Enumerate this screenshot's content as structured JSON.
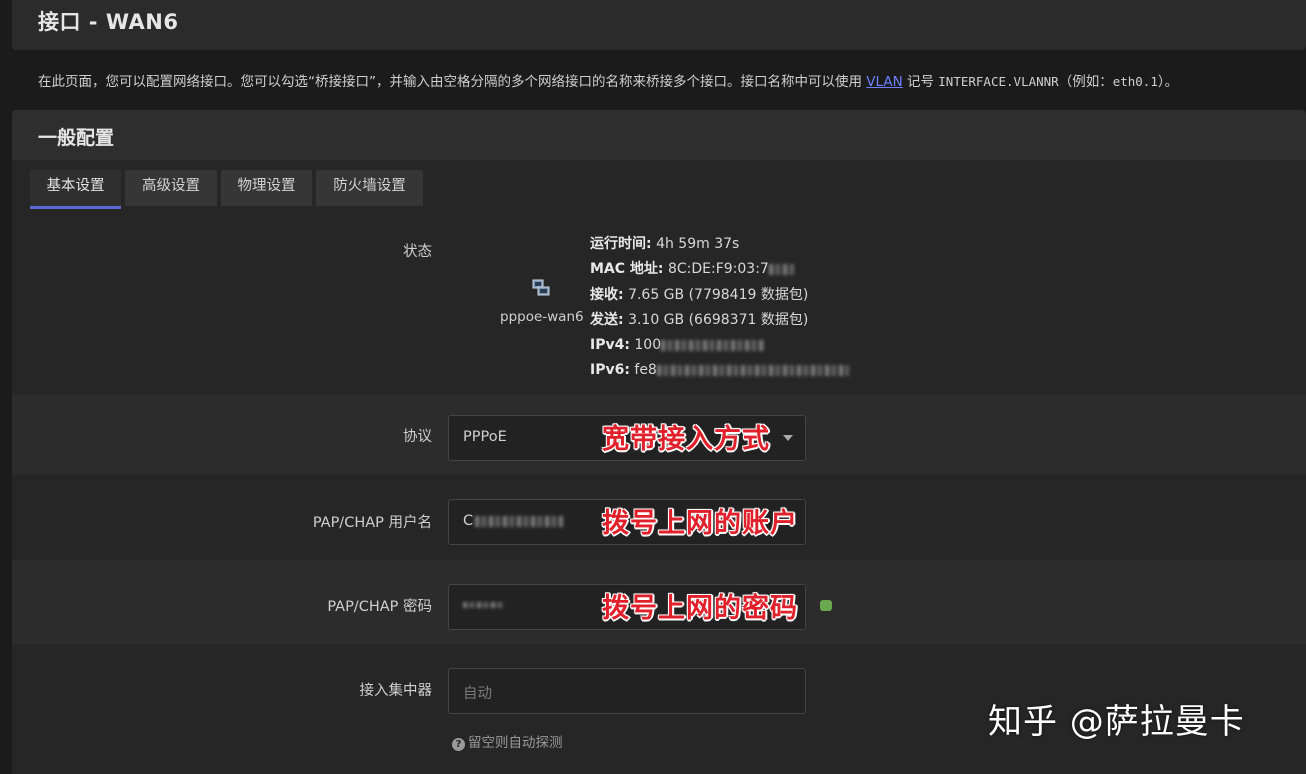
{
  "page": {
    "title": "接口 - WAN6",
    "description_before": "在此页面，您可以配置网络接口。您可以勾选“桥接接口”，并输入由空格分隔的多个网络接口的名称来桥接多个接口。接口名称中可以使用 ",
    "description_link": "VLAN",
    "description_mid": " 记号 ",
    "description_code": "INTERFACE.VLANNR",
    "description_after_code": "（例如：",
    "description_example": "eth0.1",
    "description_end": "）。"
  },
  "section": {
    "title": "一般配置"
  },
  "tabs": [
    {
      "label": "基本设置",
      "active": true
    },
    {
      "label": "高级设置",
      "active": false
    },
    {
      "label": "物理设置",
      "active": false
    },
    {
      "label": "防火墙设置",
      "active": false
    }
  ],
  "status": {
    "label": "状态",
    "interface_name": "pppoe-wan6",
    "uptime_label": "运行时间:",
    "uptime_value": "4h 59m 37s",
    "mac_label": "MAC 地址:",
    "mac_value": "8C:DE:F9:03:7",
    "rx_label": "接收:",
    "rx_value": "7.65 GB (7798419 数据包)",
    "tx_label": "发送:",
    "tx_value": "3.10 GB (6698371 数据包)",
    "ipv4_label": "IPv4:",
    "ipv4_value": "100",
    "ipv6_label": "IPv6:",
    "ipv6_value": "fe8"
  },
  "protocol": {
    "label": "协议",
    "value": "PPPoE"
  },
  "username": {
    "label": "PAP/CHAP 用户名",
    "value": "C"
  },
  "password": {
    "label": "PAP/CHAP 密码"
  },
  "concentrator": {
    "label": "接入集中器",
    "placeholder": "自动",
    "hint": "留空则自动探测"
  },
  "annotations": {
    "protocol": "宽带接入方式",
    "username": "拨号上网的账户",
    "password": "拨号上网的密码"
  },
  "watermark": "知乎 @萨拉曼卡",
  "colors": {
    "accent": "#5b6bd6",
    "annotation": "#e0202a",
    "link": "#6e7fff"
  }
}
